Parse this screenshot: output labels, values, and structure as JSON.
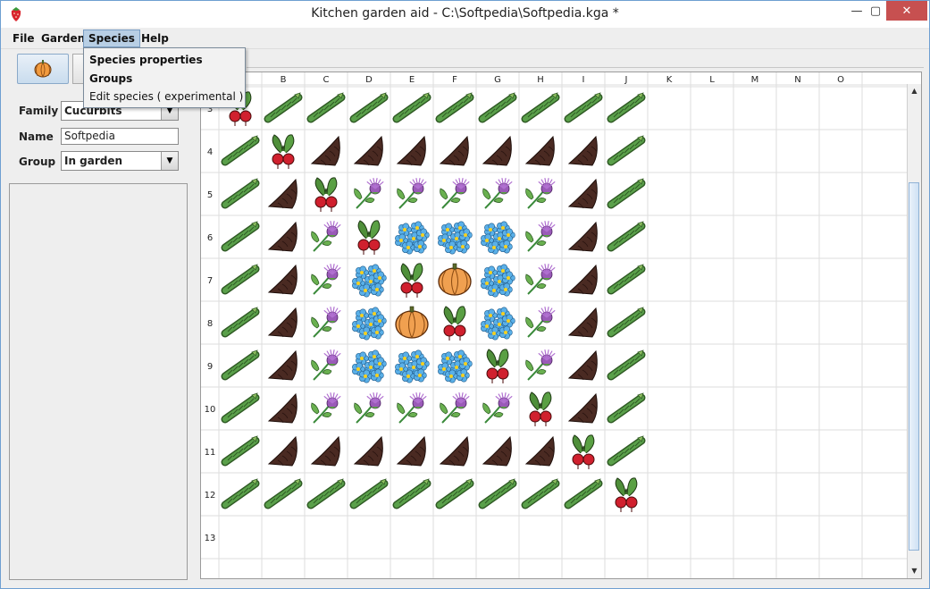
{
  "window": {
    "title": "Kitchen garden aid - C:\\Softpedia\\Softpedia.kga *"
  },
  "menu": {
    "file": "File",
    "garden": "Garden",
    "species": "Species",
    "help": "Help"
  },
  "species_menu": {
    "properties": "Species properties",
    "groups": "Groups",
    "edit": "Edit species ( experimental )"
  },
  "form": {
    "family_label": "Family",
    "family_value": "Cucurbits",
    "name_label": "Name",
    "name_value": "Softpedia",
    "group_label": "Group",
    "group_value": "In garden"
  },
  "grid": {
    "columns": [
      "A",
      "B",
      "C",
      "D",
      "E",
      "F",
      "G",
      "H",
      "I",
      "J",
      "K",
      "L",
      "M",
      "N",
      "O"
    ],
    "rows": [
      "3",
      "4",
      "5",
      "6",
      "7",
      "8",
      "9",
      "10",
      "11",
      "12",
      "13"
    ],
    "cells": [
      [
        "R",
        "A",
        "A",
        "A",
        "A",
        "A",
        "A",
        "A",
        "A",
        "A",
        "",
        "",
        "",
        "",
        ""
      ],
      [
        "A",
        "R",
        "S",
        "S",
        "S",
        "S",
        "S",
        "S",
        "S",
        "A",
        "",
        "",
        "",
        "",
        ""
      ],
      [
        "A",
        "S",
        "R",
        "T",
        "T",
        "T",
        "T",
        "T",
        "S",
        "A",
        "",
        "",
        "",
        "",
        ""
      ],
      [
        "A",
        "S",
        "T",
        "R",
        "F",
        "F",
        "F",
        "T",
        "S",
        "A",
        "",
        "",
        "",
        "",
        ""
      ],
      [
        "A",
        "S",
        "T",
        "F",
        "R",
        "P",
        "F",
        "T",
        "S",
        "A",
        "",
        "",
        "",
        "",
        ""
      ],
      [
        "A",
        "S",
        "T",
        "F",
        "P",
        "R",
        "F",
        "T",
        "S",
        "A",
        "",
        "",
        "",
        "",
        ""
      ],
      [
        "A",
        "S",
        "T",
        "F",
        "F",
        "F",
        "R",
        "T",
        "S",
        "A",
        "",
        "",
        "",
        "",
        ""
      ],
      [
        "A",
        "S",
        "T",
        "T",
        "T",
        "T",
        "T",
        "R",
        "S",
        "A",
        "",
        "",
        "",
        "",
        ""
      ],
      [
        "A",
        "S",
        "S",
        "S",
        "S",
        "S",
        "S",
        "S",
        "R",
        "A",
        "",
        "",
        "",
        "",
        ""
      ],
      [
        "A",
        "A",
        "A",
        "A",
        "A",
        "A",
        "A",
        "A",
        "A",
        "R",
        "",
        "",
        "",
        "",
        ""
      ],
      [
        "",
        "",
        "",
        "",
        "",
        "",
        "",
        "",
        "",
        "",
        "",
        "",
        "",
        "",
        ""
      ]
    ],
    "legend": {
      "A": "asparagus-icon",
      "R": "radish-icon",
      "S": "salsify-root-icon",
      "T": "thistle-icon",
      "F": "forget-me-not-icon",
      "P": "pumpkin-icon"
    }
  },
  "colors": {
    "asparagus": "#5aa04a",
    "radish": "#d0202e",
    "pumpkin": "#f0a050",
    "flower": "#5ab0e8",
    "thistle": "#9a5ab8",
    "root": "#4a2a22"
  }
}
